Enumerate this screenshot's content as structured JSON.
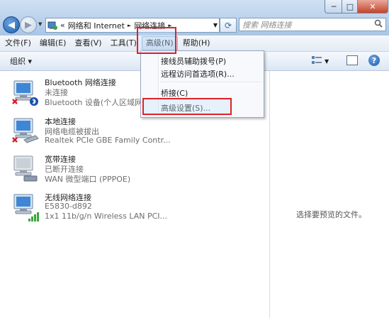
{
  "window": {
    "min_label": "─",
    "max_label": "□",
    "close_label": "✕"
  },
  "address": {
    "prefix": "«",
    "crumbs": [
      "网络和 Internet",
      "网络连接"
    ],
    "sep": "►",
    "dropdown": "▼"
  },
  "search": {
    "placeholder": "搜索 网络连接"
  },
  "menubar": {
    "items": [
      {
        "label": "文件(F)"
      },
      {
        "label": "编辑(E)"
      },
      {
        "label": "查看(V)"
      },
      {
        "label": "工具(T)"
      },
      {
        "label": "高级(N)"
      },
      {
        "label": "帮助(H)"
      }
    ]
  },
  "toolbar": {
    "organize": "组织 ▾"
  },
  "connections": [
    {
      "name": "Bluetooth 网络连接",
      "status": "未连接",
      "device": "Bluetooth 设备(个人区域网)"
    },
    {
      "name": "本地连接",
      "status": "网络电缆被拔出",
      "device": "Realtek PCIe GBE Family Contr..."
    },
    {
      "name": "宽带连接",
      "status": "已断开连接",
      "device": "WAN 微型端口 (PPPOE)"
    },
    {
      "name": "无线网络连接",
      "status": "E5830-d892",
      "device": "1x1 11b/g/n Wireless LAN PCI..."
    }
  ],
  "dropdown": {
    "items": [
      {
        "label": "接线员辅助拨号(P)"
      },
      {
        "label": "远程访问首选项(R)..."
      },
      {
        "label": "桥接(C)"
      },
      {
        "label": "高级设置(S)..."
      }
    ]
  },
  "preview": {
    "text": "选择要预览的文件。"
  },
  "colors": {
    "highlight": "#e0202a",
    "accent": "#1e5fae"
  }
}
